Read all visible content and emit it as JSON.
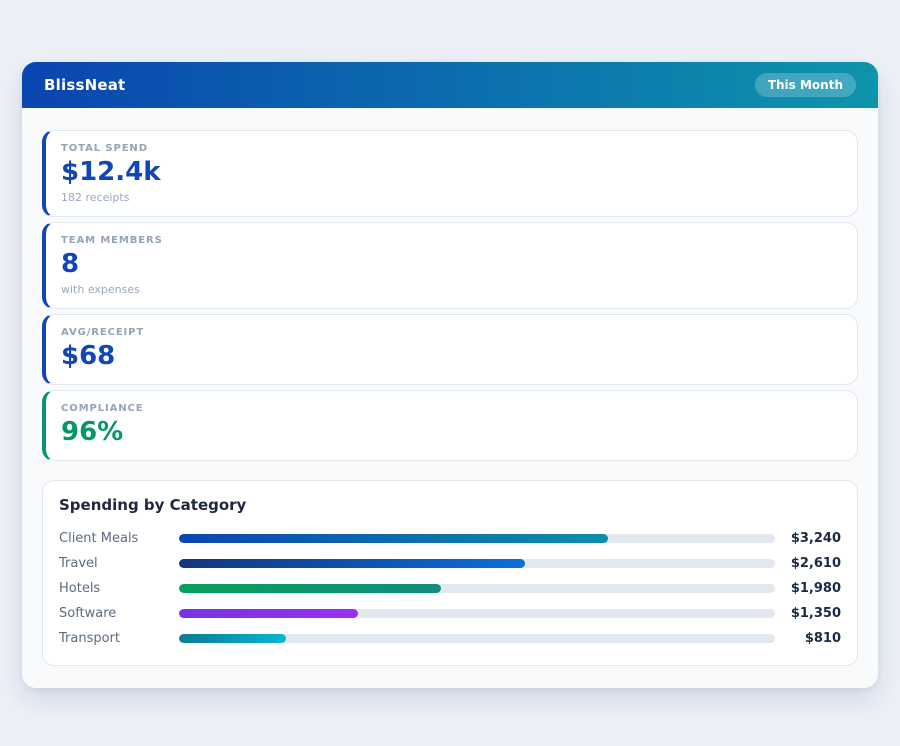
{
  "app": {
    "title": "BlissNeat",
    "period_badge": "This Month"
  },
  "theme": {
    "header_gradient_start": "#0a45b0",
    "header_gradient_end": "#0e94ac",
    "page_background": "#edf1f7",
    "card_border": "#e2e8f0",
    "accent_blue": "#1146b4",
    "accent_green": "#059669"
  },
  "stats": [
    {
      "label": "TOTAL SPEND",
      "value": "$12.4k",
      "sub": "182 receipts",
      "accent": "#1146b4"
    },
    {
      "label": "TEAM MEMBERS",
      "value": "8",
      "sub": "with expenses",
      "accent": "#1146b4"
    },
    {
      "label": "AVG/RECEIPT",
      "value": "$68",
      "sub": "",
      "accent": "#1146b4"
    },
    {
      "label": "COMPLIANCE",
      "value": "96%",
      "sub": "",
      "accent": "#059669"
    }
  ],
  "chart_data": {
    "type": "bar",
    "orientation": "horizontal",
    "title": "Spending by Category",
    "categories": [
      "Client Meals",
      "Travel",
      "Hotels",
      "Software",
      "Transport"
    ],
    "values": [
      3240,
      2610,
      1980,
      1350,
      810
    ],
    "value_labels": [
      "$3,240",
      "$2,610",
      "$1,980",
      "$1,350",
      "$810"
    ],
    "xlim": [
      0,
      4500
    ],
    "grid": false,
    "legend": false,
    "bar_gradients": [
      [
        "#0a46b0",
        "#0e8fa8"
      ],
      [
        "#14357e",
        "#0a70d8"
      ],
      [
        "#07a05c",
        "#128d7d"
      ],
      [
        "#7534e4",
        "#9c2ff0"
      ],
      [
        "#0e7a92",
        "#07b6d4"
      ]
    ],
    "track_color": "#e2e8f0"
  }
}
